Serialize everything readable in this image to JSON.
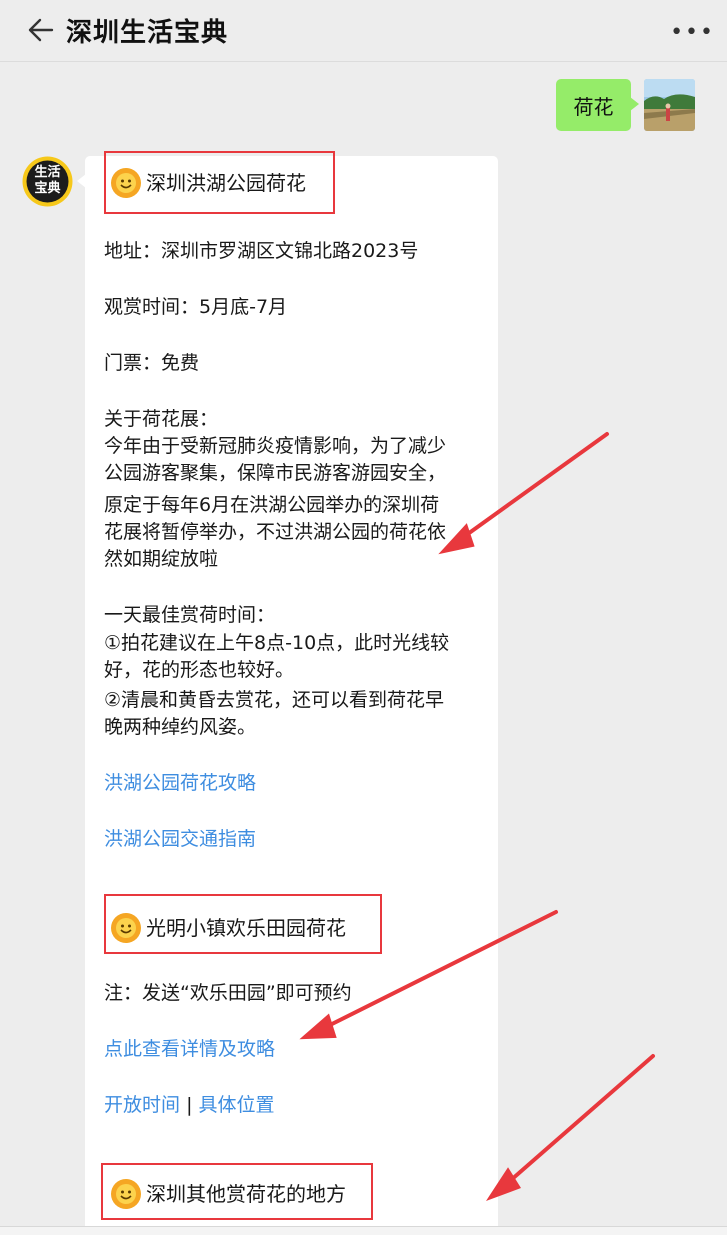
{
  "header": {
    "title": "深圳生活宝典"
  },
  "user_message": {
    "text": "荷花"
  },
  "bot": {
    "avatar_lines": [
      "生活",
      "宝典"
    ],
    "section1": {
      "title": "深圳洪湖公园荷花",
      "address": "地址：深圳市罗湖区文锦北路2023号",
      "season": "观赏时间：5月底-7月",
      "ticket": "门票：免费",
      "about_title": "关于荷花展：",
      "about_lines": [
        "今年由于受新冠肺炎疫情影响，为了减少",
        "公园游客聚集，保障市民游客游园安全，",
        "原定于每年6月在洪湖公园举办的深圳荷",
        "花展将暂停举办，不过洪湖公园的荷花依",
        "然如期绽放啦"
      ],
      "best_title": "一天最佳赏荷时间：",
      "best_lines": [
        "①拍花建议在上午8点-10点，此时光线较",
        "好，花的形态也较好。",
        "②清晨和黄昏去赏花，还可以看到荷花早",
        "晚两种绰约风姿。"
      ],
      "link1": "洪湖公园荷花攻略",
      "link2": "洪湖公园交通指南"
    },
    "section2": {
      "title": "光明小镇欢乐田园荷花",
      "note": "注：发送“欢乐田园”即可预约",
      "link_details": "点此查看详情及攻略",
      "link_hours": "开放时间",
      "separator": "|",
      "link_location": "具体位置"
    },
    "section3": {
      "title": "深圳其他赏荷花的地方"
    }
  },
  "colors": {
    "accent_red": "#e8383d",
    "link_blue": "#3e8de0",
    "bubble_green": "#95ec69"
  }
}
